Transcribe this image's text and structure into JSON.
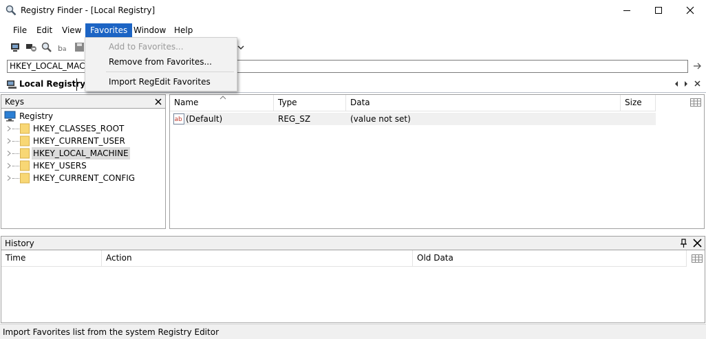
{
  "window": {
    "title": "Registry Finder - [Local Registry]"
  },
  "menu": {
    "items": [
      "File",
      "Edit",
      "View",
      "Favorites",
      "Window",
      "Help"
    ],
    "active": "Favorites"
  },
  "favorites_menu": {
    "items": [
      {
        "label": "Add to Favorites...",
        "enabled": false
      },
      {
        "label": "Remove from Favorites...",
        "enabled": true
      },
      {
        "label": "Import RegEdit Favorites",
        "enabled": true
      }
    ]
  },
  "address": {
    "value": "HKEY_LOCAL_MACHINE"
  },
  "tabs": {
    "active_label": "Local Registry"
  },
  "keys_panel": {
    "title": "Keys",
    "root": "Registry",
    "items": [
      "HKEY_CLASSES_ROOT",
      "HKEY_CURRENT_USER",
      "HKEY_LOCAL_MACHINE",
      "HKEY_USERS",
      "HKEY_CURRENT_CONFIG"
    ],
    "selected": "HKEY_LOCAL_MACHINE"
  },
  "values_panel": {
    "columns": [
      "Name",
      "Type",
      "Data",
      "Size"
    ],
    "rows": [
      {
        "name": "(Default)",
        "type": "REG_SZ",
        "data": "(value not set)",
        "size": ""
      }
    ]
  },
  "history_panel": {
    "title": "History",
    "columns": [
      "Time",
      "Action",
      "Old Data"
    ]
  },
  "status": {
    "text": "Import Favorites list from the system Registry Editor"
  },
  "colors": {
    "menu_active": "#1c64c4",
    "panel_header": "#f0f0f0",
    "folder_yellow": "#f8d775"
  }
}
